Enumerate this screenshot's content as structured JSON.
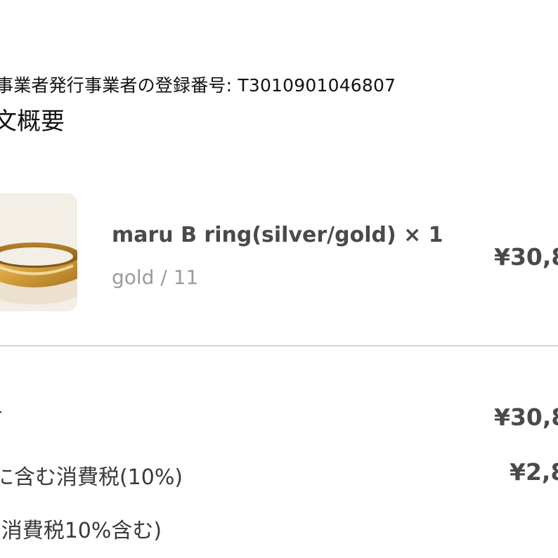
{
  "header": {
    "registration_line": "事業者発行事業者の登録番号: T3010901046807",
    "summary_title": "文概要"
  },
  "line_item": {
    "product_name": "maru B ring(silver/gold) × 1",
    "variant": "gold / 11",
    "price": "¥30,8",
    "thumbnail_icon": "gold-ring-icon"
  },
  "totals": {
    "subtotal_label": "†",
    "subtotal_value": "¥30,8",
    "tax_label": "に含む消費税(10%)",
    "tax_value": "¥2,8",
    "total_label": "(消費税10%含む)"
  },
  "colors": {
    "text_primary": "#121212",
    "text_secondary": "#4a4a4a",
    "text_muted": "#9b9b9b",
    "thumb_bg": "#f3efe6",
    "divider": "#d6d6d6",
    "gold": "#d9a441"
  }
}
